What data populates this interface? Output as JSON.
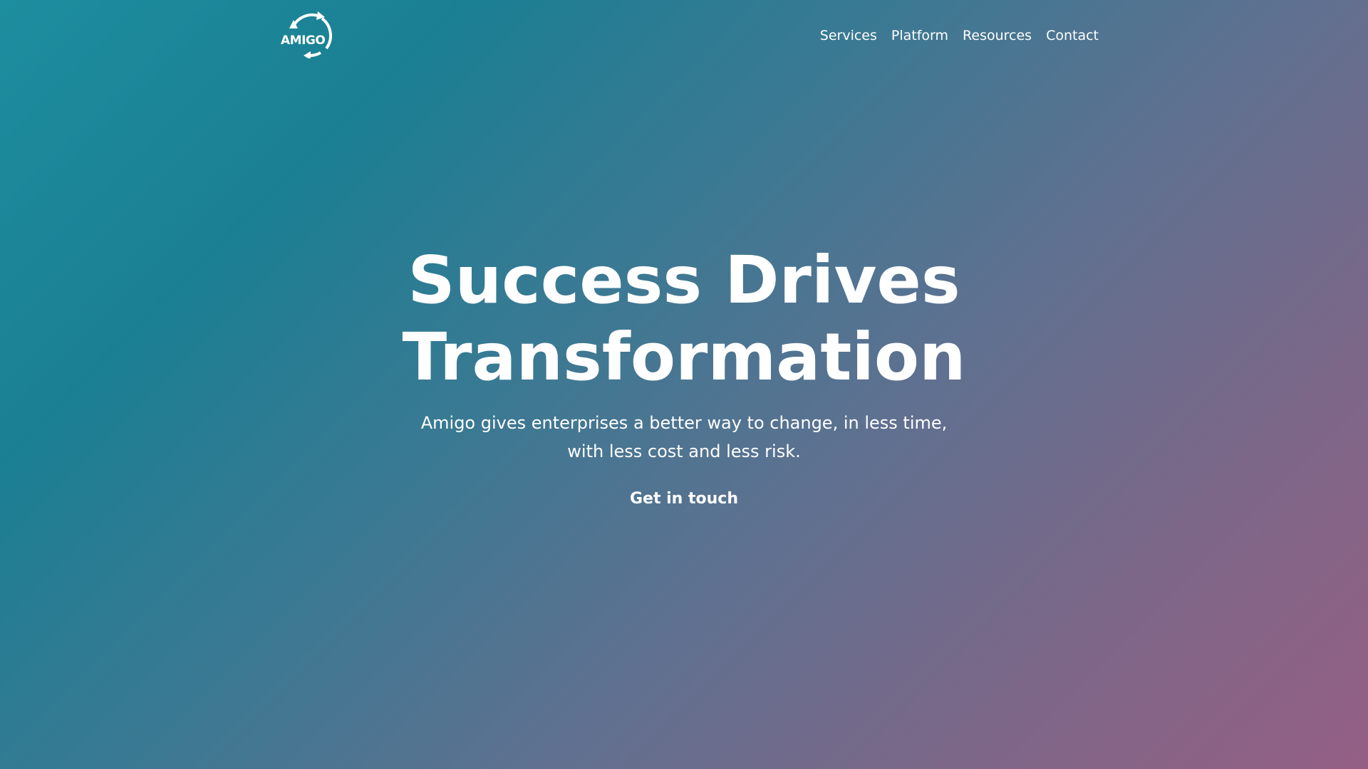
{
  "brand": {
    "logo_text": "AMIGO",
    "logo_icon": "circular-arrows-icon"
  },
  "nav": {
    "items": [
      {
        "label": "Services"
      },
      {
        "label": "Platform"
      },
      {
        "label": "Resources"
      },
      {
        "label": "Contact"
      }
    ]
  },
  "hero": {
    "title_line1": "Success Drives",
    "title_line2": "Transformation",
    "subtitle_line1": "Amigo gives enterprises a better way to change, in less time,",
    "subtitle_line2": "with less cost and less risk.",
    "cta_label": "Get in touch"
  },
  "colors": {
    "gradient_start": "#1d8e9f",
    "gradient_end": "#955f85",
    "text": "#ffffff"
  }
}
